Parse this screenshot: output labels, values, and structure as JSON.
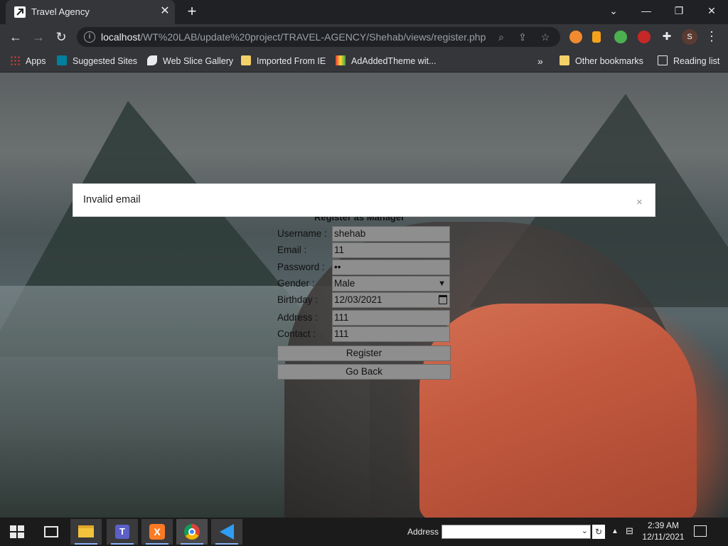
{
  "browser": {
    "tab_title": "Travel Agency",
    "tab_close": "✕",
    "new_tab": "+",
    "url_host": "localhost",
    "url_path": "/WT%20LAB/update%20project/TRAVEL-AGENCY/Shehab/views/register.php",
    "profile_initial": "S",
    "window_controls": {
      "minimize": "—",
      "restore": "❐",
      "close": "✕"
    }
  },
  "bookmarks": {
    "items": [
      "Apps",
      "Suggested Sites",
      "Web Slice Gallery",
      "Imported From IE",
      "AdAddedTheme wit..."
    ],
    "overflow": "»",
    "other": "Other bookmarks",
    "reading": "Reading list"
  },
  "alert": {
    "message": "Invalid email",
    "close": "×"
  },
  "form": {
    "title": "Register as Manager",
    "fields": [
      {
        "label": "Username :",
        "value": "shehab"
      },
      {
        "label": "Email :",
        "value": "11"
      },
      {
        "label": "Password :",
        "value": "••"
      },
      {
        "label": "Gender :",
        "value": "Male"
      },
      {
        "label": "Birthday :",
        "value": "12/03/2021"
      },
      {
        "label": "Address :",
        "value": "111"
      },
      {
        "label": "Contact :",
        "value": "111"
      }
    ],
    "register_button": "Register",
    "back_button": "Go Back"
  },
  "taskbar": {
    "address_label": "Address",
    "address_value": "",
    "time": "2:39 AM",
    "date": "12/11/2021"
  },
  "colors": {
    "chrome_dark": "#202124",
    "chrome_toolbar": "#35363a",
    "field_gray": "#8e8e8e",
    "taskbar": "#1b1b1c"
  }
}
